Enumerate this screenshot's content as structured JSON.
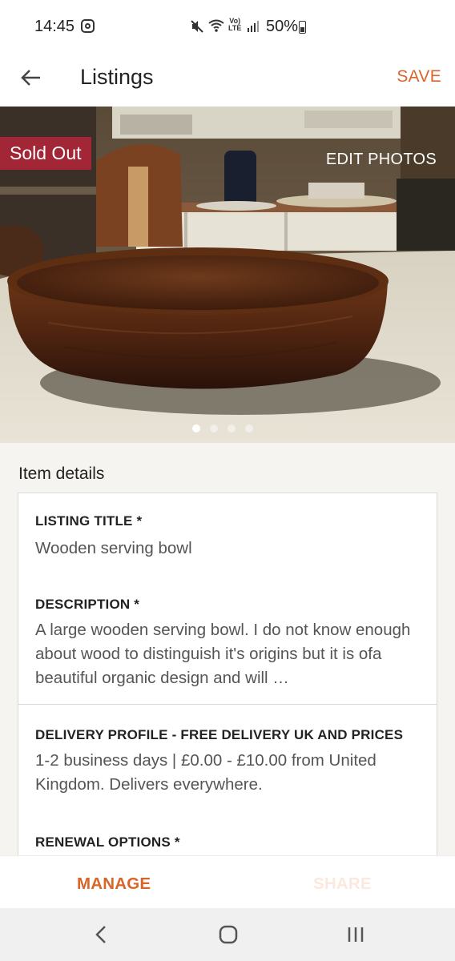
{
  "status_bar": {
    "time": "14:45",
    "battery": "50%",
    "network": "LTE"
  },
  "app_bar": {
    "title": "Listings",
    "save_label": "SAVE"
  },
  "photo": {
    "badge": "Sold Out",
    "edit_label": "EDIT PHOTOS",
    "page_count": 4,
    "current_page": 1
  },
  "details": {
    "section_label": "Item details",
    "fields": [
      {
        "label": "LISTING TITLE *",
        "value": "Wooden serving bowl"
      },
      {
        "label": "DESCRIPTION *",
        "value": "A large wooden serving bowl. I do not know enough about wood to distinguish it's origins but it is ofa beautiful organic design and will …"
      },
      {
        "label": "DELIVERY PROFILE - FREE DELIVERY UK AND PRICES",
        "value": "1-2 business days | £0.00 - £10.00 from United Kingdom. Delivers everywhere."
      },
      {
        "label": "RENEWAL OPTIONS *",
        "value": ""
      }
    ]
  },
  "actions": {
    "manage_label": "MANAGE",
    "share_label": "SHARE"
  },
  "colors": {
    "accent": "#d9652a",
    "sold_out": "#a32637",
    "share_disabled": "#fbe9e0"
  },
  "icons": {
    "back": "arrow-left-icon",
    "nav_back": "chevron-left-icon",
    "nav_home": "home-icon",
    "nav_recents": "recents-icon"
  }
}
